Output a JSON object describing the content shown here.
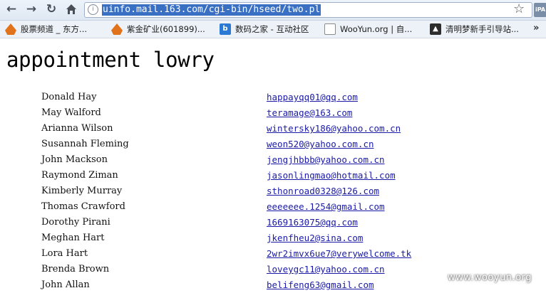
{
  "browser": {
    "url": "uinfo.mail.163.com/cgi-bin/hseed/two.pl",
    "extension_label": "iPA"
  },
  "bookmarks": [
    {
      "label": "股票频道 _ 东方...",
      "icon": "flame-icon"
    },
    {
      "label": "紫金矿业(601899)...",
      "icon": "flame-icon"
    },
    {
      "label": "数码之家 - 互动社区",
      "icon": "b-icon"
    },
    {
      "label": "WooYun.org | 自...",
      "icon": "globe-icon"
    },
    {
      "label": "清明梦新手引导站...",
      "icon": "fish-icon"
    }
  ],
  "page": {
    "title": "appointment lowry",
    "entries": [
      {
        "name": "Donald Hay",
        "email": "happayqq01@qq.com"
      },
      {
        "name": "May Walford",
        "email": "teramage@163.com"
      },
      {
        "name": "Arianna Wilson",
        "email": "wintersky186@yahoo.com.cn"
      },
      {
        "name": "Susannah Fleming",
        "email": "weon520@yahoo.com.cn"
      },
      {
        "name": "John Mackson",
        "email": "jengjhbbb@yahoo.com.cn"
      },
      {
        "name": "Raymond Ziman",
        "email": "jasonlingmao@hotmail.com"
      },
      {
        "name": "Kimberly Murray",
        "email": "sthonroad0328@126.com"
      },
      {
        "name": "Thomas Crawford",
        "email": "eeeeeee.1254@gmail.com"
      },
      {
        "name": "Dorothy Pirani",
        "email": "1669163075@qq.com"
      },
      {
        "name": "Meghan Hart",
        "email": "jkenfheu2@sina.com"
      },
      {
        "name": "Lora Hart",
        "email": "2wr2imvx6ue7@verywelcome.tk"
      },
      {
        "name": "Brenda Brown",
        "email": "loveygc11@yahoo.com.cn"
      },
      {
        "name": "John Allan",
        "email": "belifeng63@gmail.com"
      }
    ]
  },
  "watermark": "www.wooyun.org"
}
